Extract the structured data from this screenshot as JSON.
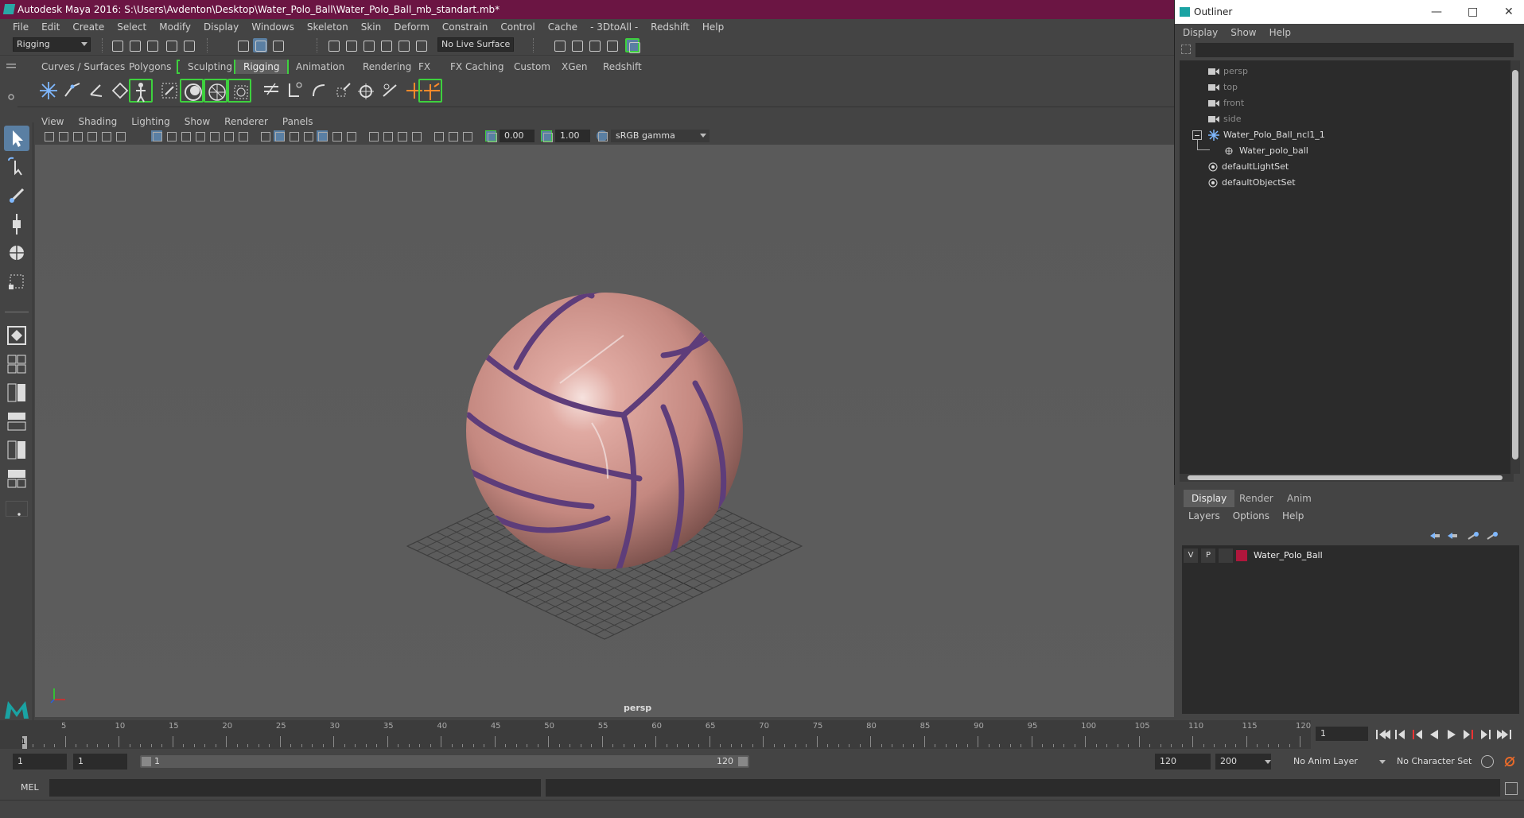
{
  "title": "Autodesk Maya 2016: S:\\Users\\Avdenton\\Desktop\\Water_Polo_Ball\\Water_Polo_Ball_mb_standart.mb*",
  "menu": [
    "File",
    "Edit",
    "Create",
    "Select",
    "Modify",
    "Display",
    "Windows",
    "Skeleton",
    "Skin",
    "Deform",
    "Constrain",
    "Control",
    "Cache",
    "- 3DtoAll -",
    "Redshift",
    "Help"
  ],
  "toolbar": {
    "mode": "Rigging",
    "live_surface": "No Live Surface"
  },
  "shelf_tabs": [
    "Curves / Surfaces",
    "Polygons",
    "Sculpting",
    "Rigging",
    "Animation",
    "Rendering",
    "FX",
    "FX Caching",
    "Custom",
    "XGen",
    "Redshift"
  ],
  "active_shelf": "Rigging",
  "viewport": {
    "menu": [
      "View",
      "Shading",
      "Lighting",
      "Show",
      "Renderer",
      "Panels"
    ],
    "exposure": "0.00",
    "gamma": "1.00",
    "color_space": "sRGB gamma",
    "camera_label": "persp"
  },
  "timeline": {
    "ticks": [
      5,
      10,
      15,
      20,
      25,
      30,
      35,
      40,
      45,
      50,
      55,
      60,
      65,
      70,
      75,
      80,
      85,
      90,
      95,
      100,
      105,
      110,
      115,
      120
    ],
    "current_frame": "1",
    "current_frame_field": "1"
  },
  "range": {
    "start": "1",
    "playback_start": "1",
    "slider_start": "1",
    "slider_end": "120",
    "playback_end": "120",
    "end": "200",
    "anim_layer": "No Anim Layer",
    "character_set": "No Character Set"
  },
  "mel": {
    "label": "MEL"
  },
  "outliner": {
    "title": "Outliner",
    "menu": [
      "Display",
      "Show",
      "Help"
    ],
    "items": [
      {
        "label": "persp",
        "dim": true,
        "indent": 1,
        "icon": "camera-icon"
      },
      {
        "label": "top",
        "dim": true,
        "indent": 1,
        "icon": "camera-icon"
      },
      {
        "label": "front",
        "dim": true,
        "indent": 1,
        "icon": "camera-icon"
      },
      {
        "label": "side",
        "dim": true,
        "indent": 1,
        "icon": "camera-icon"
      },
      {
        "label": "Water_Polo_Ball_ncl1_1",
        "dim": false,
        "indent": 1,
        "icon": "joint-icon",
        "expanded": true
      },
      {
        "label": "Water_polo_ball",
        "dim": false,
        "indent": 2,
        "icon": "mesh-icon"
      },
      {
        "label": "defaultLightSet",
        "dim": false,
        "indent": 1,
        "icon": "set-icon"
      },
      {
        "label": "defaultObjectSet",
        "dim": false,
        "indent": 1,
        "icon": "set-icon"
      }
    ]
  },
  "layers": {
    "tabs": [
      "Display",
      "Render",
      "Anim"
    ],
    "active_tab": "Display",
    "menu": [
      "Layers",
      "Options",
      "Help"
    ],
    "rows": [
      {
        "v": "V",
        "p": "P",
        "color": "#b0163c",
        "name": "Water_Polo_Ball"
      }
    ]
  },
  "colors": {
    "title_bar": "#6b1543",
    "accent_green": "#3ed13e",
    "selection_blue": "#5a7fa3",
    "ball": "#c99088",
    "ball_seam": "#5e3d7a"
  }
}
